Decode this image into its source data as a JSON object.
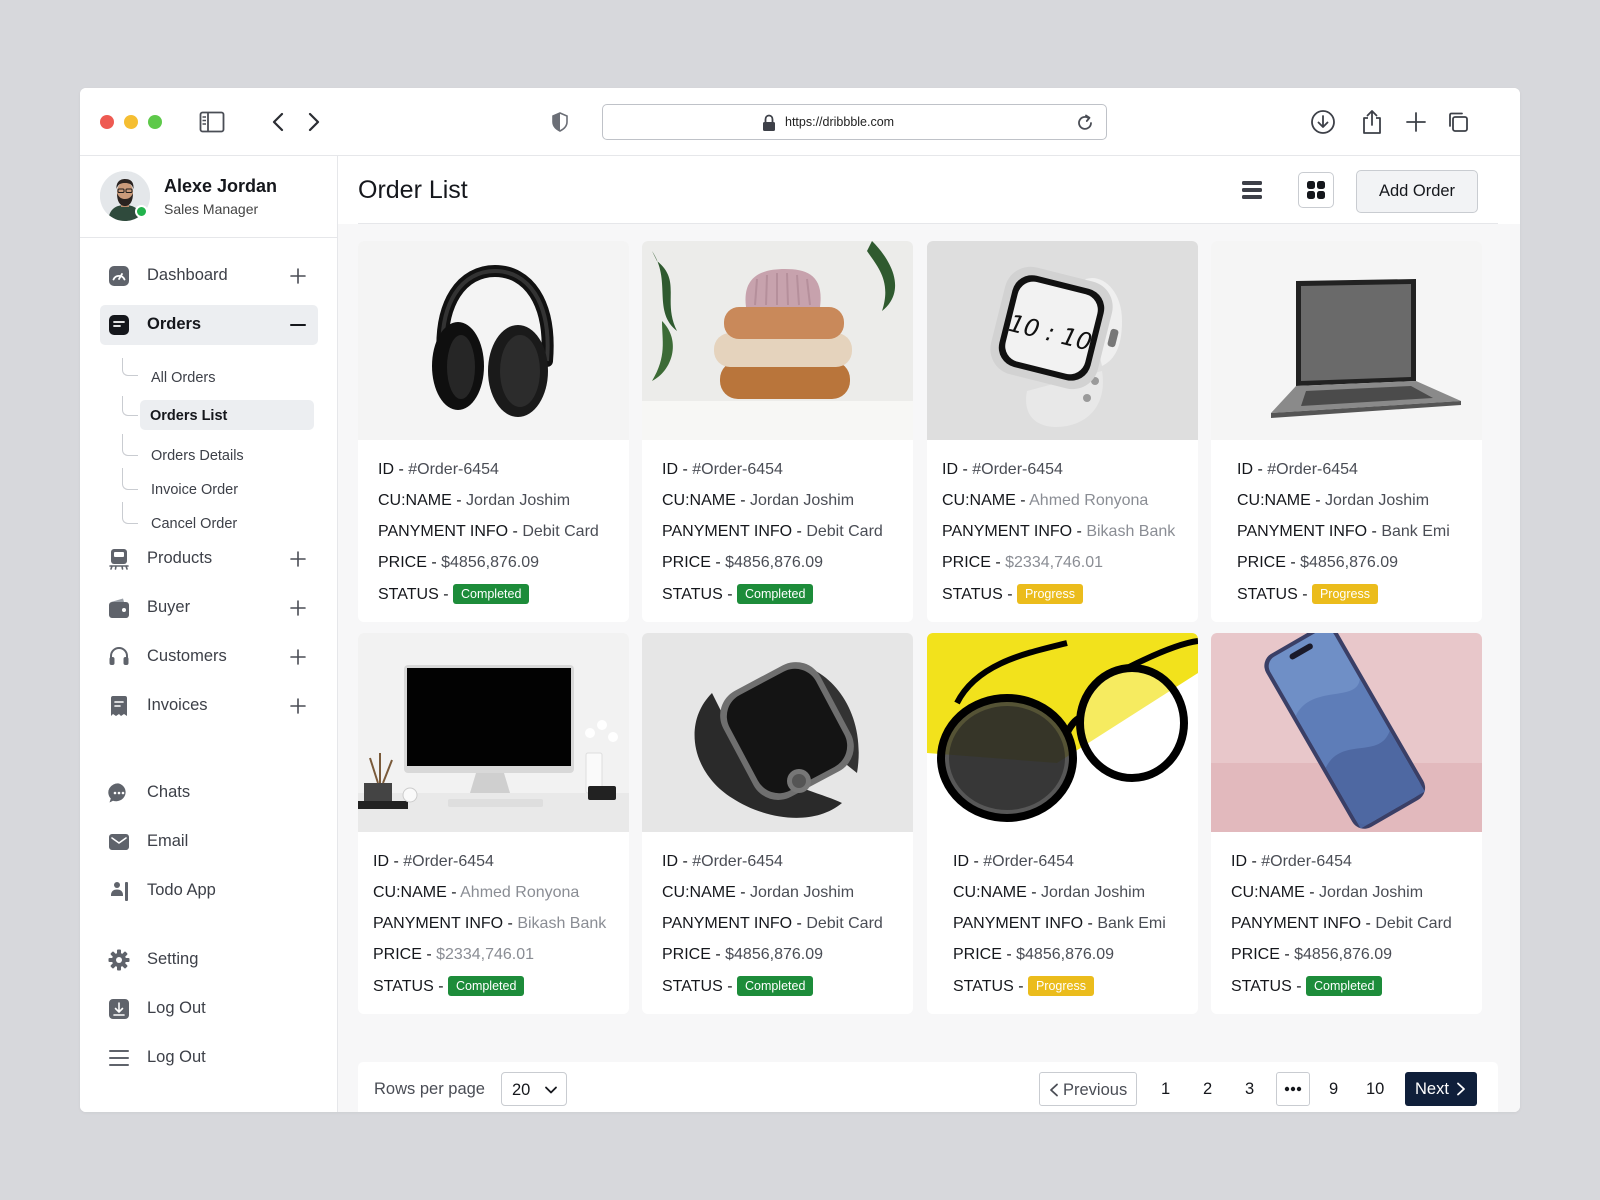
{
  "browser": {
    "url": "https://dribbble.com",
    "icons": [
      "sidebar-toggle-icon",
      "back-icon",
      "forward-icon",
      "shield-icon",
      "lock-icon",
      "reload-icon",
      "download-icon",
      "share-icon",
      "new-tab-icon",
      "tabs-icon"
    ]
  },
  "profile": {
    "name": "Alexe Jordan",
    "role": "Sales Manager",
    "status_color": "#22b24c"
  },
  "nav": {
    "dashboard": "Dashboard",
    "orders": "Orders",
    "orders_sub": [
      "All Orders",
      "Orders List",
      "Orders Details",
      "Invoice Order",
      "Cancel Order"
    ],
    "products": "Products",
    "buyer": "Buyer",
    "customers": "Customers",
    "invoices": "Invoices",
    "chats": "Chats",
    "email": "Email",
    "todo": "Todo App",
    "setting": "Setting",
    "logout1": "Log Out",
    "logout2": "Log Out"
  },
  "header": {
    "title": "Order List",
    "add_button": "Add Order"
  },
  "labels": {
    "id": "ID - ",
    "name": "CU:NAME - ",
    "payment": "PANYMENT INFO - ",
    "price": "PRICE - ",
    "status": "STATUS - "
  },
  "orders": [
    {
      "product": "headphones",
      "id": "#Order-6454",
      "customer": "Jordan Joshim",
      "payment": "Debit Card",
      "price": "$4856,876.09",
      "status": "Completed"
    },
    {
      "product": "sweaters",
      "id": "#Order-6454",
      "customer": "Jordan Joshim",
      "payment": "Debit Card",
      "price": "$4856,876.09",
      "status": "Completed"
    },
    {
      "product": "smartwatch-white",
      "id": "#Order-6454",
      "customer": "Ahmed Ronyona",
      "payment": "Bikash Bank",
      "price": "$2334,746.01",
      "status": "Progress"
    },
    {
      "product": "laptop",
      "id": "#Order-6454",
      "customer": "Jordan Joshim",
      "payment": "Bank Emi",
      "price": "$4856,876.09",
      "status": "Progress"
    },
    {
      "product": "desktop-monitor",
      "id": "#Order-6454",
      "customer": "Ahmed Ronyona",
      "payment": "Bikash Bank",
      "price": "$2334,746.01",
      "status": "Completed"
    },
    {
      "product": "smartwatch-black",
      "id": "#Order-6454",
      "customer": "Jordan Joshim",
      "payment": "Debit Card",
      "price": "$4856,876.09",
      "status": "Completed"
    },
    {
      "product": "eyeglasses",
      "id": "#Order-6454",
      "customer": "Jordan Joshim",
      "payment": "Bank Emi",
      "price": "$4856,876.09",
      "status": "Progress"
    },
    {
      "product": "smartphone",
      "id": "#Order-6454",
      "customer": "Jordan Joshim",
      "payment": "Debit Card",
      "price": "$4856,876.09",
      "status": "Completed"
    }
  ],
  "watch_face_time": "10:10",
  "pagination": {
    "rows_label": "Rows per page",
    "rows_value": "20",
    "previous": "Previous",
    "next": "Next",
    "pages": [
      "1",
      "2",
      "3",
      "9",
      "10"
    ]
  },
  "colors": {
    "completed": "#1d8c3a",
    "progress": "#ebbc1c",
    "next_button": "#0f1f3a"
  }
}
